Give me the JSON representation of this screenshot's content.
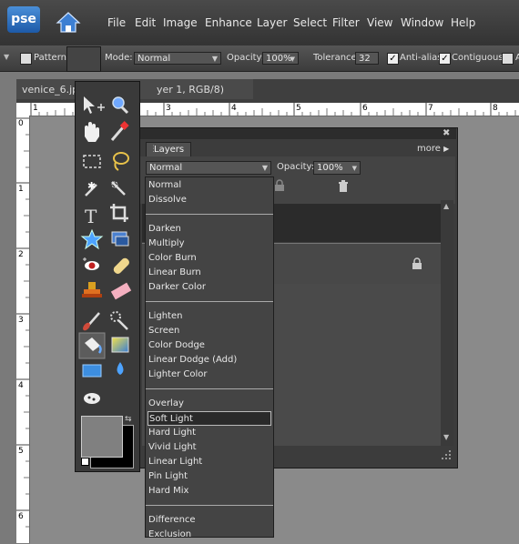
{
  "app": {
    "logo_text": "pse"
  },
  "menu": [
    "File",
    "Edit",
    "Image",
    "Enhance",
    "Layer",
    "Select",
    "Filter",
    "View",
    "Window",
    "Help"
  ],
  "options_bar": {
    "pattern_label": "Pattern",
    "mode_label": "Mode:",
    "mode_value": "Normal",
    "opacity_label": "Opacity:",
    "opacity_value": "100%",
    "tolerance_label": "Tolerance:",
    "tolerance_value": "32",
    "antialias_label": "Anti-alias",
    "contiguous_label": "Contiguous",
    "all_layers_label": "A"
  },
  "document": {
    "tab_title": "venice_6.jp",
    "tab_suffix": "yer 1, RGB/8)",
    "ruler_top": [
      "1",
      "2",
      "3",
      "4",
      "5",
      "6",
      "7",
      "8"
    ],
    "ruler_left": [
      "0",
      "1",
      "2",
      "3",
      "4",
      "5",
      "6"
    ]
  },
  "layers_panel": {
    "tab_label": "Layers",
    "more_label": "more",
    "blend_mode": "Normal",
    "opacity_label": "Opacity:",
    "opacity_value": "100%"
  },
  "blend_dropdown": {
    "groups": [
      [
        "Normal",
        "Dissolve"
      ],
      [
        "Darken",
        "Multiply",
        "Color Burn",
        "Linear Burn",
        "Darker Color"
      ],
      [
        "Lighten",
        "Screen",
        "Color Dodge",
        "Linear Dodge (Add)",
        "Lighter Color"
      ],
      [
        "Overlay",
        "Soft Light",
        "Hard Light",
        "Vivid Light",
        "Linear Light",
        "Pin Light",
        "Hard Mix"
      ],
      [
        "Difference",
        "Exclusion"
      ]
    ],
    "selected": "Soft Light"
  },
  "toolbox": {
    "tools": [
      "move-tool-icon",
      "zoom-tool-icon",
      "hand-tool-icon",
      "eyedropper-tool-icon",
      "marquee-tool-icon",
      "lasso-tool-icon",
      "magic-wand-tool-icon",
      "quick-selection-tool-icon",
      "type-tool-icon",
      "crop-tool-icon",
      "cookie-cutter-tool-icon",
      "straighten-tool-icon",
      "red-eye-tool-icon",
      "healing-brush-tool-icon",
      "clone-stamp-tool-icon",
      "eraser-tool-icon",
      "brush-tool-icon",
      "smart-brush-tool-icon",
      "paint-bucket-tool-icon",
      "gradient-tool-icon",
      "shape-tool-icon",
      "blur-tool-icon",
      "sponge-tool-icon"
    ],
    "selected": "paint-bucket-tool-icon"
  },
  "colors": {
    "foreground": "#808080",
    "background": "#000000",
    "accent": "#3c7fd0"
  }
}
